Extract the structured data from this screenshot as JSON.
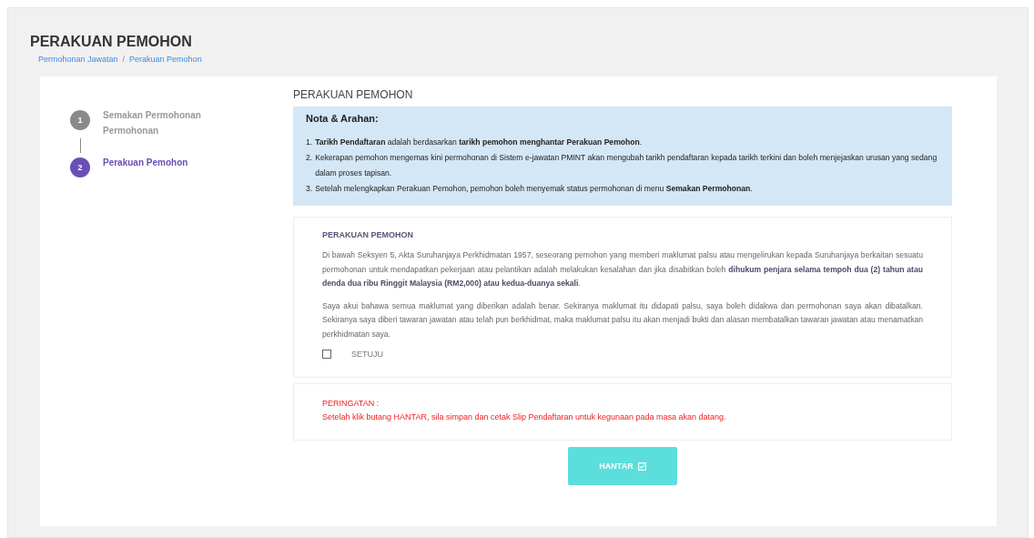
{
  "page": {
    "title": "PERAKUAN PEMOHON"
  },
  "breadcrumb": {
    "separator": "/",
    "items": [
      "Permohonan Jawatan",
      "Perakuan Pemohon"
    ]
  },
  "steps": [
    {
      "number": "1",
      "label": "Semakan Permohonan Permohonan",
      "selected": false
    },
    {
      "number": "2",
      "label": "Perakuan Pemohon",
      "selected": true
    }
  ],
  "section_title": "PERAKUAN PEMOHON",
  "notes": {
    "title": "Nota & Arahan:",
    "items": [
      {
        "marker": "1.",
        "text": "**Tarikh Pendaftaran** adalah berdasarkan **tarikh pemohon menghantar Perakuan Pemohon**."
      },
      {
        "marker": "2.",
        "text": "Kekerapan pemohon mengemas kini permohonan di Sistem e-jawatan PMINT akan mengubah tarikh pendaftaran kepada tarikh terkini dan boleh menjejaskan urusan yang sedang dalam proses tapisan."
      },
      {
        "marker": "3.",
        "text": "Setelah melengkapkan Perakuan Pemohon, pemohon boleh menyemak status permohonan di menu **Semakan Permohonan**."
      }
    ]
  },
  "declaration": {
    "title": "PERAKUAN PEMOHON",
    "paragraphs": [
      "Di bawah Seksyen 5, Akta Suruhanjaya Perkhidmatan 1957, seseorang pemohon yang memberi maklumat palsu atau mengelirukan kepada Suruhanjaya berkaitan sesuatu permohonan untuk mendapatkan pekerjaan atau pelantikan adalah melakukan kesalahan dan jika disabitkan boleh **dihukum penjara selama tempoh dua (2) tahun atau denda dua ribu Ringgit Malaysia (RM2,000) atau kedua-duanya sekali**.",
      "Saya akui bahawa semua maklumat yang diberikan adalah benar. Sekiranya maklumat itu didapati palsu, saya boleh didakwa dan permohonan saya akan dibatalkan. Sekiranya saya diberi tawaran jawatan atau telah pun berkhidmat, maka maklumat palsu itu akan menjadi bukti dan alasan membatalkan tawaran jawatan atau menamatkan perkhidmatan saya."
    ],
    "agree": {
      "label": "SETUJU",
      "checked": false
    }
  },
  "warning": {
    "title": "PERINGATAN :",
    "text": "Setelah klik butang HANTAR, sila simpan dan cetak Slip Pendaftaran untuk kegunaan pada masa akan datang."
  },
  "submit_button": {
    "label": "HANTAR"
  }
}
